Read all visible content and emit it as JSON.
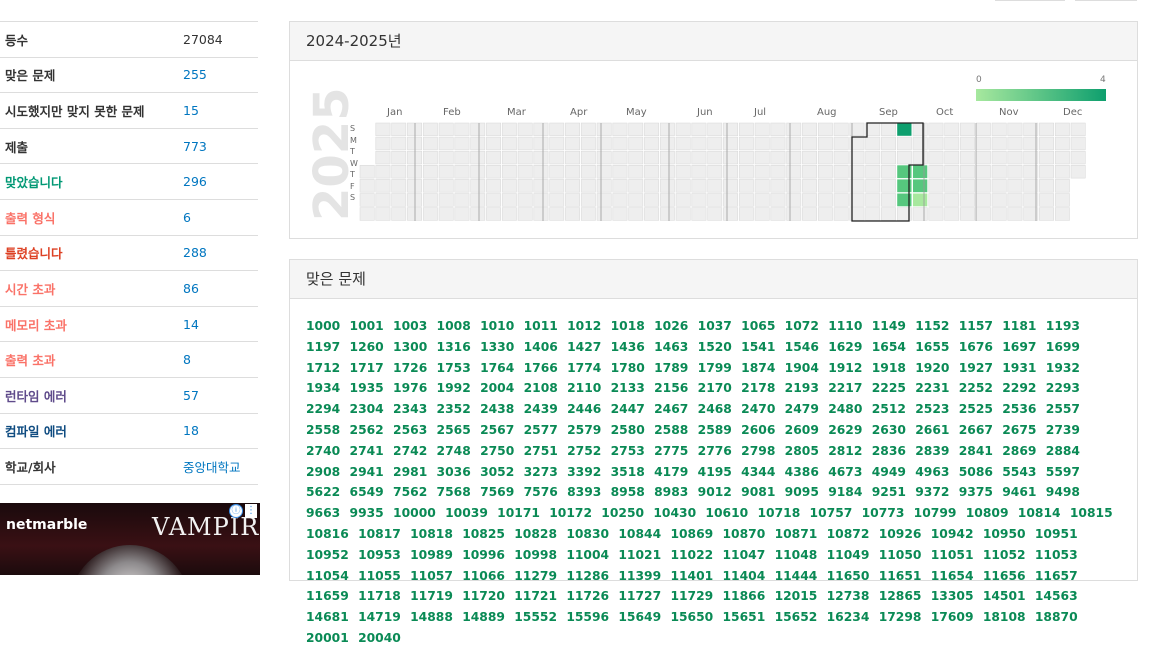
{
  "stats": [
    {
      "label": "등수",
      "value": "27084",
      "label_color": "#333333",
      "value_link": false
    },
    {
      "label": "맞은 문제",
      "value": "255",
      "label_color": "#333333",
      "value_link": true
    },
    {
      "label": "시도했지만 맞지 못한 문제",
      "value": "15",
      "label_color": "#333333",
      "value_link": true
    },
    {
      "label": "제출",
      "value": "773",
      "label_color": "#333333",
      "value_link": true
    },
    {
      "label": "맞았습니다",
      "value": "296",
      "label_color": "#009874",
      "value_link": true
    },
    {
      "label": "출력 형식",
      "value": "6",
      "label_color": "#fa7268",
      "value_link": true
    },
    {
      "label": "틀렸습니다",
      "value": "288",
      "label_color": "#dd4124",
      "value_link": true
    },
    {
      "label": "시간 초과",
      "value": "86",
      "label_color": "#fa7268",
      "value_link": true
    },
    {
      "label": "메모리 초과",
      "value": "14",
      "label_color": "#fa7268",
      "value_link": true
    },
    {
      "label": "출력 초과",
      "value": "8",
      "label_color": "#fa7268",
      "value_link": true
    },
    {
      "label": "런타임 에러",
      "value": "57",
      "label_color": "#5f4b8b",
      "value_link": true
    },
    {
      "label": "컴파일 에러",
      "value": "18",
      "label_color": "#0f4c81",
      "value_link": true
    },
    {
      "label": "학교/회사",
      "value": "중앙대학교",
      "label_color": "#333333",
      "value_link": true
    }
  ],
  "ad": {
    "brand": "netmarble",
    "title": "VAMPIR",
    "info": "ⓘ",
    "more": "⋮"
  },
  "heatmap": {
    "title": "2024-2025년",
    "year": "2025",
    "legend_min": "0",
    "legend_max": "4",
    "day_labels": [
      "S",
      "M",
      "T",
      "W",
      "T",
      "F",
      "S"
    ],
    "months": [
      "Jan",
      "Feb",
      "Mar",
      "Apr",
      "May",
      "Jun",
      "Jul",
      "Aug",
      "Sep",
      "Oct",
      "Nov",
      "Dec"
    ],
    "colors": {
      "level1": "#a7e89e",
      "level2": "#56c77e",
      "level4": "#0e9f6e",
      "empty": "#eeeeee"
    }
  },
  "solved_panel": {
    "title": "맞은 문제",
    "problems": [
      "1000",
      "1001",
      "1003",
      "1008",
      "1010",
      "1011",
      "1012",
      "1018",
      "1026",
      "1037",
      "1065",
      "1072",
      "1110",
      "1149",
      "1152",
      "1157",
      "1181",
      "1193",
      "1197",
      "1260",
      "1300",
      "1316",
      "1330",
      "1406",
      "1427",
      "1436",
      "1463",
      "1520",
      "1541",
      "1546",
      "1629",
      "1654",
      "1655",
      "1676",
      "1697",
      "1699",
      "1712",
      "1717",
      "1726",
      "1753",
      "1764",
      "1766",
      "1774",
      "1780",
      "1789",
      "1799",
      "1874",
      "1904",
      "1912",
      "1918",
      "1920",
      "1927",
      "1931",
      "1932",
      "1934",
      "1935",
      "1976",
      "1992",
      "2004",
      "2108",
      "2110",
      "2133",
      "2156",
      "2170",
      "2178",
      "2193",
      "2217",
      "2225",
      "2231",
      "2252",
      "2292",
      "2293",
      "2294",
      "2304",
      "2343",
      "2352",
      "2438",
      "2439",
      "2446",
      "2447",
      "2467",
      "2468",
      "2470",
      "2479",
      "2480",
      "2512",
      "2523",
      "2525",
      "2536",
      "2557",
      "2558",
      "2562",
      "2563",
      "2565",
      "2567",
      "2577",
      "2579",
      "2580",
      "2588",
      "2589",
      "2606",
      "2609",
      "2629",
      "2630",
      "2661",
      "2667",
      "2675",
      "2739",
      "2740",
      "2741",
      "2742",
      "2748",
      "2750",
      "2751",
      "2752",
      "2753",
      "2775",
      "2776",
      "2798",
      "2805",
      "2812",
      "2836",
      "2839",
      "2841",
      "2869",
      "2884",
      "2908",
      "2941",
      "2981",
      "3036",
      "3052",
      "3273",
      "3392",
      "3518",
      "4179",
      "4195",
      "4344",
      "4386",
      "4673",
      "4949",
      "4963",
      "5086",
      "5543",
      "5597",
      "5622",
      "6549",
      "7562",
      "7568",
      "7569",
      "7576",
      "8393",
      "8958",
      "8983",
      "9012",
      "9081",
      "9095",
      "9184",
      "9251",
      "9372",
      "9375",
      "9461",
      "9498",
      "9663",
      "9935",
      "10000",
      "10039",
      "10171",
      "10172",
      "10250",
      "10430",
      "10610",
      "10718",
      "10757",
      "10773",
      "10799",
      "10809",
      "10814",
      "10815",
      "10816",
      "10817",
      "10818",
      "10825",
      "10828",
      "10830",
      "10844",
      "10869",
      "10870",
      "10871",
      "10872",
      "10926",
      "10942",
      "10950",
      "10951",
      "10952",
      "10953",
      "10989",
      "10996",
      "10998",
      "11004",
      "11021",
      "11022",
      "11047",
      "11048",
      "11049",
      "11050",
      "11051",
      "11052",
      "11053",
      "11054",
      "11055",
      "11057",
      "11066",
      "11279",
      "11286",
      "11399",
      "11401",
      "11404",
      "11444",
      "11650",
      "11651",
      "11654",
      "11656",
      "11657",
      "11659",
      "11718",
      "11719",
      "11720",
      "11721",
      "11726",
      "11727",
      "11729",
      "11866",
      "12015",
      "12738",
      "12865",
      "13305",
      "14501",
      "14563",
      "14681",
      "14719",
      "14888",
      "14889",
      "15552",
      "15596",
      "15649",
      "15650",
      "15651",
      "15652",
      "16234",
      "17298",
      "17609",
      "18108",
      "18870",
      "20001",
      "20040"
    ]
  }
}
